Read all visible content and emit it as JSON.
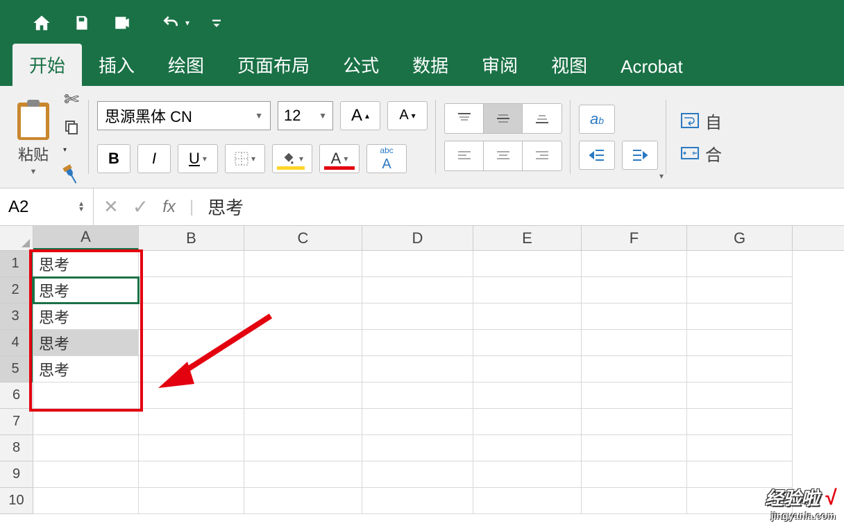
{
  "quickAccess": {},
  "tabs": {
    "items": [
      "开始",
      "插入",
      "绘图",
      "页面布局",
      "公式",
      "数据",
      "审阅",
      "视图",
      "Acrobat"
    ],
    "activeIndex": 0
  },
  "ribbon": {
    "pasteLabel": "粘贴",
    "fontName": "思源黑体 CN",
    "fontSize": "12",
    "bold": "B",
    "italic": "I",
    "underline": "U",
    "increaseFont": "A",
    "decreaseFont": "A",
    "fontColorLetter": "A",
    "fillLetter": "",
    "phonetic": "abc",
    "phoneticA": "A",
    "autoFitLabel": "自",
    "mergeLabel": "合"
  },
  "nameBox": {
    "ref": "A2"
  },
  "formulaBar": {
    "fx": "fx",
    "value": "思考"
  },
  "grid": {
    "columns": [
      "A",
      "B",
      "C",
      "D",
      "E",
      "F",
      "G"
    ],
    "rowNumbers": [
      "1",
      "2",
      "3",
      "4",
      "5",
      "6",
      "7",
      "8",
      "9",
      "10"
    ],
    "activeCell": "A2",
    "selection": {
      "col": "A",
      "rows": [
        1,
        2,
        3,
        4,
        5
      ]
    },
    "cells": {
      "A1": "思考",
      "A2": "思考",
      "A3": "思考",
      "A4": "思考",
      "A5": "思考"
    }
  },
  "watermark": {
    "line1": "经验啦",
    "check": "√",
    "line2": "jingyanla.com"
  }
}
